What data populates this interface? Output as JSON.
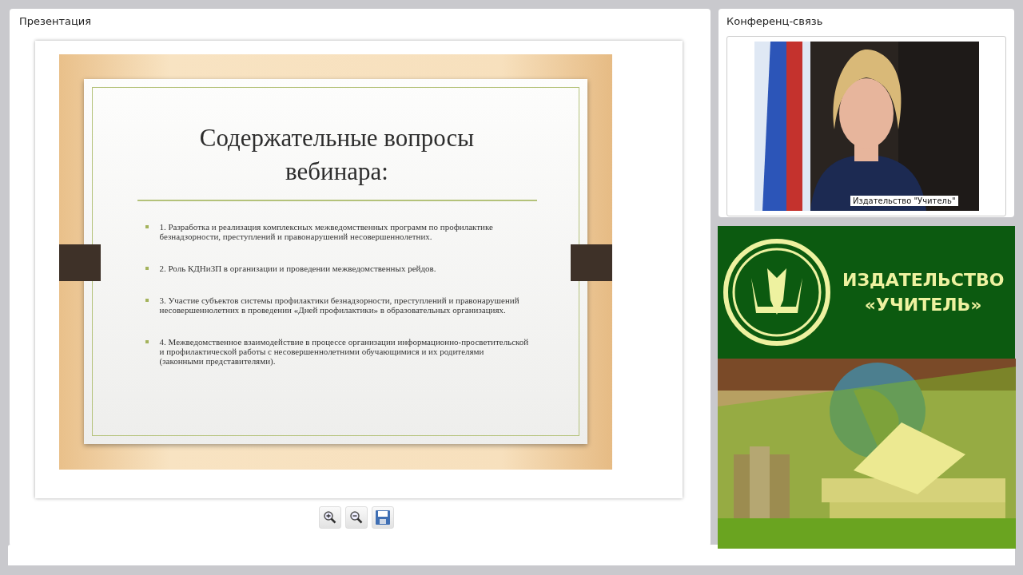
{
  "presentation": {
    "title": "Презентация",
    "slide": {
      "title": "Содержательные вопросы вебинара:",
      "bullets": [
        "1. Разработка и реализация комплексных межведомственных программ по профилактике безнадзорности, преступлений и правонарушений несовершеннолетних.",
        "2. Роль КДНиЗП в организации и проведении межведомственных рейдов.",
        "3. Участие субъектов системы профилактики безнадзорности, преступлений и правонарушений несовершеннолетних в проведении «Дней профилактики» в образовательных организациях.",
        "4. Межведомственное взаимодействие в процессе организации информационно-просветительской и профилактической работы с несовершеннолетними обучающимися и их родителями (законными представителями)."
      ]
    },
    "tools": [
      {
        "kind": "zoom-in"
      },
      {
        "kind": "zoom-out"
      },
      {
        "kind": "save"
      }
    ]
  },
  "conference": {
    "title": "Конференц-связь",
    "video": {
      "kind": "picture",
      "caption": "Издательство \"Учитель\""
    }
  },
  "banner": {
    "line_1": "ИЗДАТЕЛЬСТВО",
    "line_2": "«УЧИТЕЛЬ»"
  }
}
